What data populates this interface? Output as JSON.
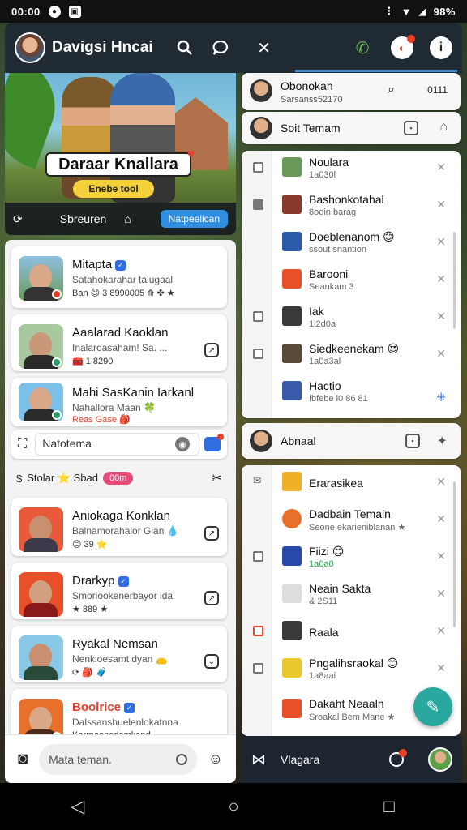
{
  "status_bar": {
    "time": "00:00",
    "battery": "98%"
  },
  "app_bar": {
    "title": "Davigsi Hncai",
    "actions": [
      "search-icon",
      "chat-bubble-icon",
      "close-icon",
      "phone-icon",
      "notification-icon",
      "info-icon"
    ],
    "notification_badge": "2"
  },
  "hero": {
    "banner_title": "Daraar Knallara",
    "banner_sub": "Enebe tool",
    "bottom_label": "Sbreuren",
    "button_label": "Natpeelican"
  },
  "left_cards": [
    {
      "name": "Mitapta",
      "sub": "Satahokarahar talugaal",
      "meta": "Ban 😊 3 8990005 ⟰ ✤ ★"
    },
    {
      "name": "Aaalarad Kaoklan",
      "sub": "Inalaroasaham! Sa. ...",
      "meta": "🧰 1 8290"
    },
    {
      "name": "Mahi SasKanin Iarkanl",
      "sub": "Nahallora Maan 🍀",
      "meta": "Reas Gase 🎒"
    }
  ],
  "search": {
    "placeholder": "Natotema"
  },
  "tag_row": {
    "label": "Stolar ⭐ Sbad",
    "tag": "00m"
  },
  "left_cards2": [
    {
      "name": "Aniokaga Konklan",
      "sub": "Balnamorahalor Gian 💧",
      "meta": "😊 39 ⭐"
    },
    {
      "name": "Drarkyp",
      "sub": "Smoriookenerbayor idal",
      "meta": "★ 889 ★"
    },
    {
      "name": "Ryakal Nemsan",
      "sub": "Nenkioesamt dyan 👝",
      "meta": "⟳ 🎒 🧳"
    },
    {
      "name": "Boolrice",
      "sub": "Dalssanshuelenlokatnna",
      "meta": "Karrnoonedamkand"
    }
  ],
  "bottom_left": {
    "input_placeholder": "Mata teman."
  },
  "right_top": [
    {
      "name": "Obonokan",
      "sub": "Sarsanss52170",
      "right": "0111"
    },
    {
      "name": "Soit Temam"
    }
  ],
  "list1": [
    {
      "name": "Noulara",
      "sub": "1a030l"
    },
    {
      "name": "Bashonkotahal",
      "sub": "8ooin barag"
    },
    {
      "name": "Doeblenanom 😊",
      "sub": "ssout snantion"
    },
    {
      "name": "Barooni",
      "sub": "Seankam 3"
    },
    {
      "name": "Iak",
      "sub": "1l2d0a"
    },
    {
      "name": "Siedkeenekam 😍",
      "sub": "1a0a3al"
    },
    {
      "name": "Hactio",
      "sub": "Ibfebe l0 86 81"
    }
  ],
  "mid_card": {
    "name": "Abnaal"
  },
  "list2": [
    {
      "name": "Erarasikea",
      "sub": ""
    },
    {
      "name": "Dadbain Temain",
      "sub": "Seone ekarieniblanan ★"
    },
    {
      "name": "Fiizi 😊",
      "sub": "1a0a0"
    },
    {
      "name": "Neain Sakta",
      "sub": "& 2S11"
    },
    {
      "name": "Raala",
      "sub": ""
    },
    {
      "name": "Pngalihsraokal 😊",
      "sub": "1a8aai"
    },
    {
      "name": "Dakaht Neaaln",
      "sub": "Sroakal Bem Mane ★"
    }
  ],
  "bottom_right": {
    "label": "Vlagara",
    "badge": "3"
  },
  "colors": {
    "accent": "#2f8ee0",
    "app_bar": "#1f2a33",
    "fab": "#2aa8a0",
    "alert": "#e8402a"
  }
}
